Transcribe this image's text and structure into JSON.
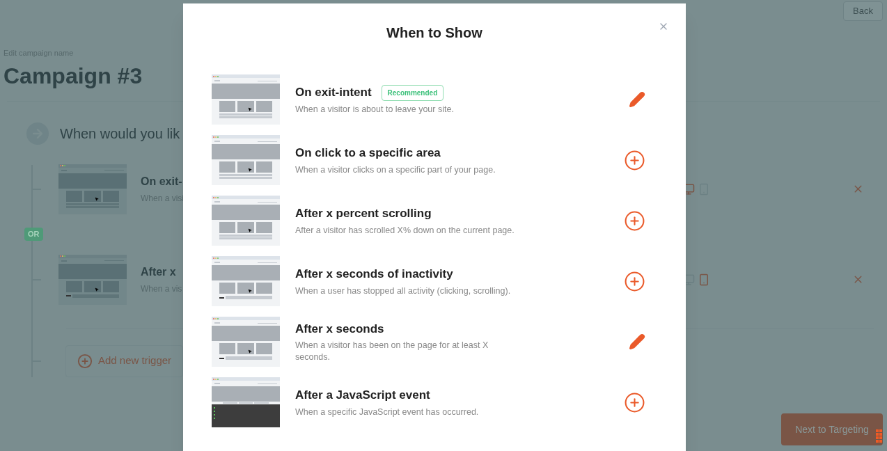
{
  "page": {
    "back_button": "Back",
    "edit_label": "Edit campaign name",
    "campaign_title": "Campaign #3",
    "section_heading": "When would you lik",
    "triggers": [
      {
        "title": "On exit-",
        "description": "When a visi",
        "thumbnail": {
          "kind": "cards"
        },
        "desktop": true,
        "mobile": false
      },
      {
        "title": "After x",
        "description": "When a vis",
        "thumbnail": {
          "kind": "timer"
        },
        "desktop": false,
        "mobile": true
      }
    ],
    "or_badge": "OR",
    "add_trigger_button": "Add new trigger",
    "next_button": "Next to Targeting"
  },
  "modal": {
    "title": "When to Show",
    "options": [
      {
        "title": "On exit-intent",
        "badge": "Recommended",
        "description": "When a visitor is about to leave your site.",
        "thumbnail": {
          "kind": "cards"
        },
        "action": {
          "kind": "edit"
        }
      },
      {
        "title": "On click to a specific area",
        "description": "When a visitor clicks on a specific part of your page.",
        "thumbnail": {
          "kind": "cards"
        },
        "action": {
          "kind": "add"
        }
      },
      {
        "title": "After x percent scrolling",
        "description": "After a visitor has scrolled X% down on the current page.",
        "thumbnail": {
          "kind": "cards"
        },
        "action": {
          "kind": "add"
        }
      },
      {
        "title": "After x seconds of inactivity",
        "description": "When a user has stopped all activity (clicking, scrolling).",
        "thumbnail": {
          "kind": "timer"
        },
        "action": {
          "kind": "add"
        }
      },
      {
        "title": "After x seconds",
        "description": "When a visitor has been on the page for at least X seconds.",
        "thumbnail": {
          "kind": "timer"
        },
        "action": {
          "kind": "edit"
        }
      },
      {
        "title": "After a JavaScript event",
        "description": "When a specific JavaScript event has occurred.",
        "thumbnail": {
          "kind": "console"
        },
        "action": {
          "kind": "add"
        }
      }
    ]
  }
}
